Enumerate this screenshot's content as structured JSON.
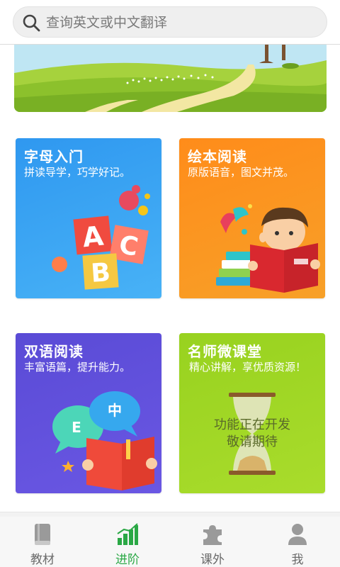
{
  "search": {
    "placeholder": "查询英文或中文翻译"
  },
  "cards": [
    {
      "title": "字母入门",
      "subtitle": "拼读导学，巧学好记。",
      "letters": [
        "A",
        "B",
        "C"
      ]
    },
    {
      "title": "绘本阅读",
      "subtitle": "原版语音，图文并茂。"
    },
    {
      "title": "双语阅读",
      "subtitle": "丰富语篇，提升能力。",
      "bubbles": [
        "E",
        "中"
      ]
    },
    {
      "title": "名师微课堂",
      "subtitle": "精心讲解，享优质资源！",
      "status_line1": "功能正在开发",
      "status_line2": "敬请期待"
    }
  ],
  "tabs": [
    {
      "label": "教材",
      "icon": "book-icon",
      "active": false
    },
    {
      "label": "进阶",
      "icon": "chart-bars-icon",
      "active": true
    },
    {
      "label": "课外",
      "icon": "puzzle-icon",
      "active": false
    },
    {
      "label": "我",
      "icon": "person-icon",
      "active": false
    }
  ],
  "colors": {
    "active_tab": "#2aa845",
    "inactive_tab": "#9a9a9a",
    "card_blue": "#3ba4f3",
    "card_orange": "#fb9420",
    "card_purple": "#5f50dd",
    "card_green": "#a2d826"
  }
}
